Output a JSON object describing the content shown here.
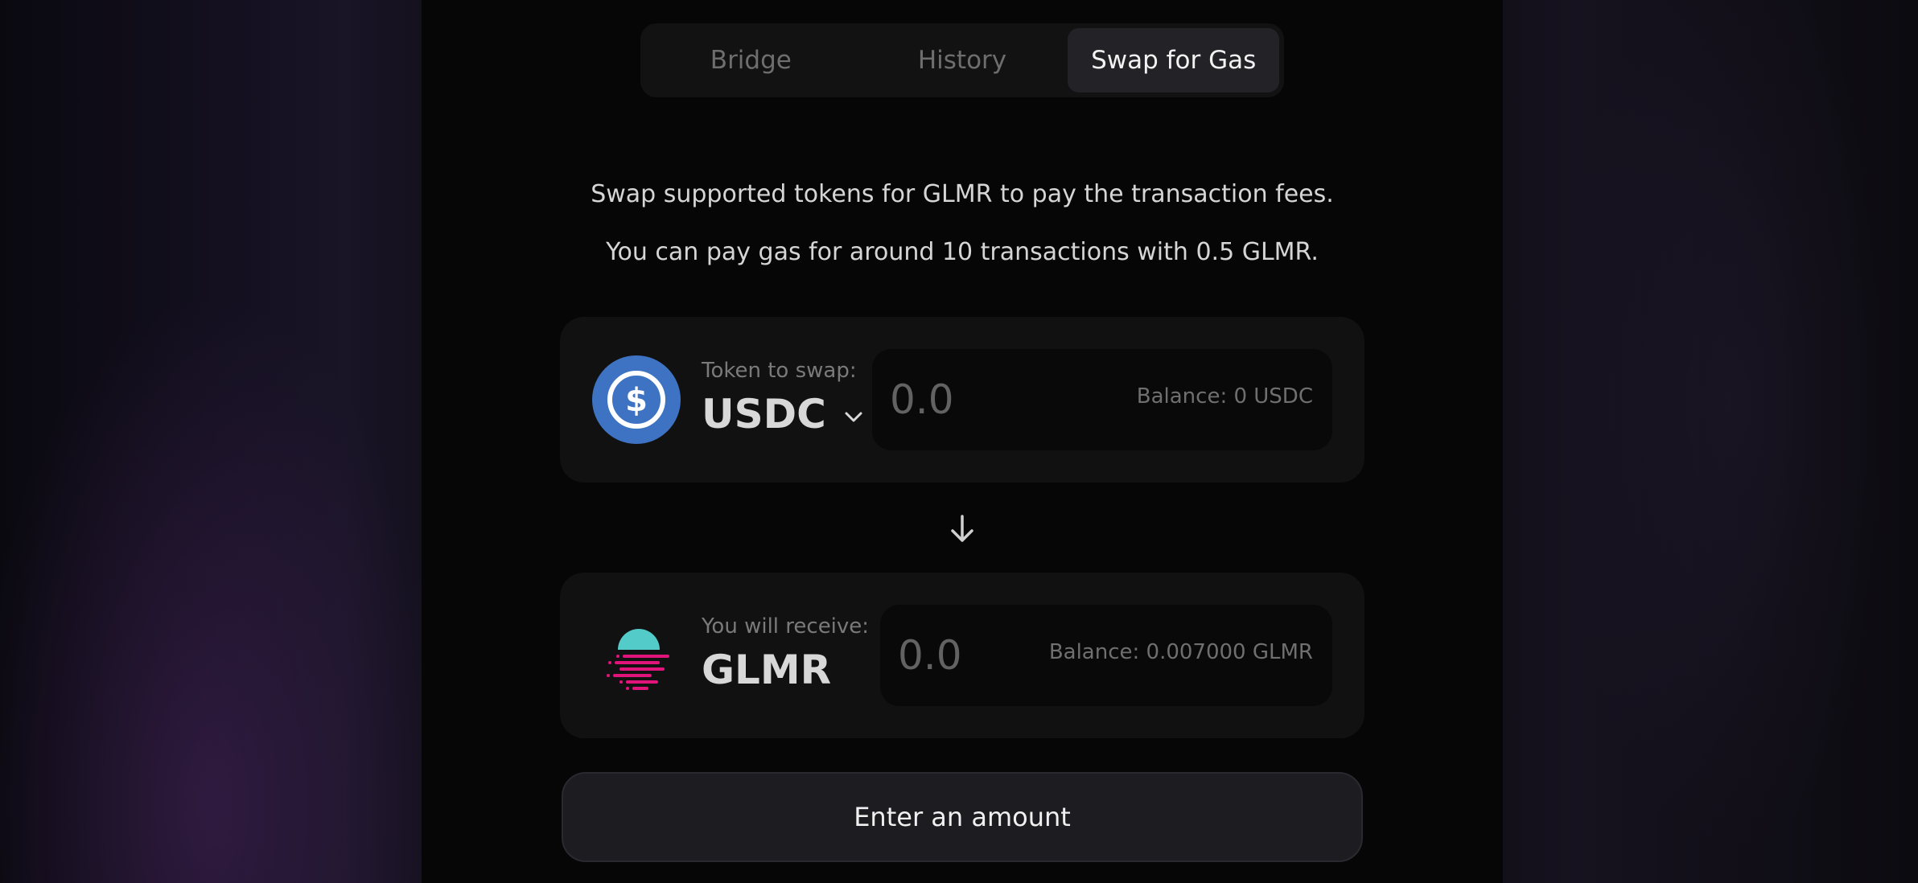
{
  "tabs": [
    {
      "label": "Bridge",
      "active": false
    },
    {
      "label": "History",
      "active": false
    },
    {
      "label": "Swap for Gas",
      "active": true
    }
  ],
  "description": {
    "line1": "Swap supported tokens for GLMR to pay the transaction fees.",
    "line2": "You can pay gas for around 10 transactions with 0.5 GLMR."
  },
  "swap_from": {
    "label": "Token to swap:",
    "token": "USDC",
    "token_icon": "usdc-icon",
    "amount_placeholder": "0.0",
    "balance": "Balance: 0 USDC"
  },
  "swap_to": {
    "label": "You will receive:",
    "token": "GLMR",
    "token_icon": "glmr-icon",
    "amount_placeholder": "0.0",
    "balance": "Balance: 0.007000 GLMR"
  },
  "action": {
    "label": "Enter an amount"
  },
  "colors": {
    "usdc_blue": "#3e73c4",
    "glmr_teal": "#53cbc9",
    "glmr_pink": "#e1147b"
  }
}
